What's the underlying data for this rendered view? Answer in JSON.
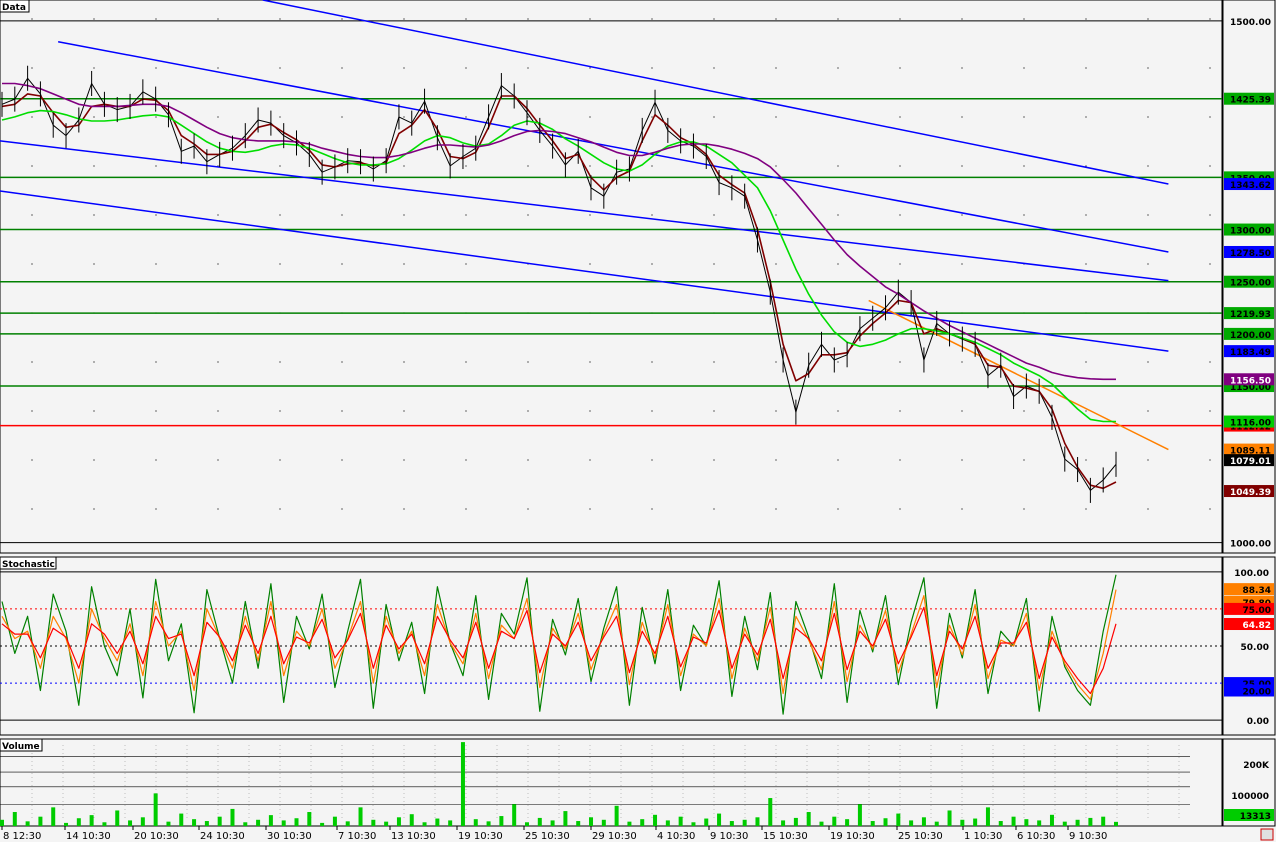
{
  "panels": {
    "price": {
      "title": "Data"
    },
    "stochastic": {
      "title": "Stochastic"
    },
    "volume": {
      "title": "Volume"
    }
  },
  "chart_data": [
    {
      "type": "line",
      "panel": "price",
      "title": "Data",
      "ylim": [
        990,
        1520
      ],
      "y_tick_labels": [
        1500.0,
        1000.0
      ],
      "horizontal_levels": [
        {
          "value": 1500.0,
          "color": "#000000",
          "label": "1500.00"
        },
        {
          "value": 1425.39,
          "color": "#008000",
          "label": "1425.39"
        },
        {
          "value": 1350.0,
          "color": "#008000",
          "label": "1350.00"
        },
        {
          "value": 1300.0,
          "color": "#008000",
          "label": "1300.00"
        },
        {
          "value": 1250.0,
          "color": "#008000",
          "label": "1250.00"
        },
        {
          "value": 1219.93,
          "color": "#008000",
          "label": "1219.93"
        },
        {
          "value": 1200.0,
          "color": "#008000",
          "label": "1200.00"
        },
        {
          "value": 1150.0,
          "color": "#008000",
          "label": "1150.00"
        },
        {
          "value": 1112.12,
          "color": "#ff0000",
          "label": "1112.12"
        },
        {
          "value": 1000.0,
          "color": "#000000",
          "label": "1000.00"
        }
      ],
      "axis_badges": [
        {
          "value": 1343.62,
          "label": "1343.62",
          "bg": "#0000ff",
          "fg": "#000000"
        },
        {
          "value": 1278.5,
          "label": "1278.50",
          "bg": "#0000ff",
          "fg": "#000000"
        },
        {
          "value": 1183.49,
          "label": "1183.49",
          "bg": "#0000ff",
          "fg": "#000000"
        },
        {
          "value": 1156.5,
          "label": "1156.50",
          "bg": "#800080",
          "fg": "#ffffff"
        },
        {
          "value": 1116.0,
          "label": "1116.00",
          "bg": "#00cc00",
          "fg": "#000000"
        },
        {
          "value": 1089.11,
          "label": "1089.11",
          "bg": "#ff8000",
          "fg": "#000000"
        },
        {
          "value": 1079.01,
          "label": "1079.01",
          "bg": "#000000",
          "fg": "#ffffff"
        },
        {
          "value": 1049.39,
          "label": "1049.39",
          "bg": "#800000",
          "fg": "#ffffff"
        }
      ],
      "trend_lines": [
        {
          "color": "#0000ff",
          "p1": [
            0.235,
            1520
          ],
          "p2": [
            0.978,
            1343.62
          ]
        },
        {
          "color": "#0000ff",
          "p1": [
            0.052,
            1480
          ],
          "p2": [
            0.978,
            1278.5
          ]
        },
        {
          "color": "#0000ff",
          "p1": [
            0.0,
            1385
          ],
          "p2": [
            0.978,
            1251
          ]
        },
        {
          "color": "#0000ff",
          "p1": [
            0.0,
            1337
          ],
          "p2": [
            0.978,
            1183.49
          ]
        },
        {
          "color": "#ff8000",
          "p1": [
            0.777,
            1232
          ],
          "p2": [
            0.978,
            1089.11
          ]
        }
      ],
      "series": [
        {
          "name": "",
          "role": "price",
          "color": "#000000",
          "values": [
            1420,
            1425,
            1445,
            1430,
            1400,
            1390,
            1405,
            1440,
            1420,
            1415,
            1418,
            1432,
            1425,
            1410,
            1375,
            1380,
            1365,
            1372,
            1378,
            1390,
            1405,
            1402,
            1390,
            1383,
            1372,
            1355,
            1360,
            1366,
            1365,
            1358,
            1366,
            1408,
            1402,
            1423,
            1388,
            1361,
            1370,
            1378,
            1408,
            1438,
            1428,
            1412,
            1395,
            1380,
            1362,
            1375,
            1340,
            1332,
            1355,
            1358,
            1395,
            1422,
            1395,
            1385,
            1380,
            1370,
            1345,
            1340,
            1332,
            1290,
            1240,
            1175,
            1125,
            1170,
            1190,
            1175,
            1180,
            1205,
            1215,
            1225,
            1240,
            1230,
            1175,
            1210,
            1200,
            1195,
            1190,
            1160,
            1170,
            1140,
            1150,
            1145,
            1120,
            1080,
            1070,
            1050,
            1060,
            1075
          ]
        },
        {
          "name": "",
          "role": "fast-ma",
          "color": "#800000",
          "values": [
            1418,
            1420,
            1430,
            1428,
            1412,
            1398,
            1400,
            1418,
            1420,
            1418,
            1418,
            1425,
            1424,
            1414,
            1390,
            1382,
            1372,
            1372,
            1375,
            1385,
            1398,
            1401,
            1393,
            1386,
            1376,
            1362,
            1360,
            1363,
            1364,
            1361,
            1364,
            1392,
            1400,
            1415,
            1396,
            1370,
            1368,
            1374,
            1398,
            1428,
            1428,
            1416,
            1400,
            1385,
            1368,
            1372,
            1350,
            1338,
            1350,
            1356,
            1385,
            1410,
            1400,
            1388,
            1382,
            1372,
            1352,
            1343,
            1335,
            1300,
            1250,
            1190,
            1155,
            1162,
            1180,
            1180,
            1182,
            1198,
            1210,
            1220,
            1232,
            1230,
            1200,
            1205,
            1200,
            1196,
            1190,
            1170,
            1168,
            1150,
            1148,
            1145,
            1128,
            1095,
            1072,
            1055,
            1052,
            1058
          ]
        },
        {
          "name": "",
          "role": "slow-ma",
          "color": "#00dd00",
          "values": [
            1405,
            1408,
            1412,
            1414,
            1413,
            1410,
            1406,
            1404,
            1404,
            1405,
            1407,
            1409,
            1410,
            1408,
            1400,
            1392,
            1384,
            1378,
            1375,
            1374,
            1376,
            1380,
            1382,
            1381,
            1378,
            1373,
            1368,
            1364,
            1362,
            1362,
            1363,
            1368,
            1376,
            1385,
            1390,
            1388,
            1383,
            1380,
            1382,
            1390,
            1400,
            1404,
            1402,
            1396,
            1387,
            1380,
            1372,
            1364,
            1358,
            1356,
            1362,
            1372,
            1380,
            1384,
            1384,
            1380,
            1372,
            1364,
            1352,
            1340,
            1318,
            1290,
            1262,
            1238,
            1218,
            1202,
            1192,
            1188,
            1190,
            1194,
            1200,
            1205,
            1205,
            1203,
            1200,
            1196,
            1192,
            1186,
            1180,
            1172,
            1166,
            1160,
            1152,
            1140,
            1128,
            1118,
            1116,
            1116
          ]
        },
        {
          "name": "",
          "role": "long-ma",
          "color": "#800080",
          "values": [
            1440,
            1440,
            1438,
            1435,
            1430,
            1425,
            1420,
            1418,
            1418,
            1418,
            1419,
            1420,
            1420,
            1418,
            1412,
            1405,
            1398,
            1392,
            1388,
            1386,
            1385,
            1385,
            1385,
            1384,
            1382,
            1378,
            1375,
            1372,
            1370,
            1369,
            1369,
            1371,
            1374,
            1378,
            1381,
            1381,
            1380,
            1379,
            1381,
            1385,
            1390,
            1394,
            1395,
            1394,
            1392,
            1388,
            1384,
            1379,
            1374,
            1371,
            1371,
            1374,
            1378,
            1381,
            1382,
            1382,
            1380,
            1377,
            1373,
            1368,
            1360,
            1348,
            1335,
            1320,
            1305,
            1290,
            1276,
            1265,
            1255,
            1245,
            1238,
            1230,
            1222,
            1215,
            1208,
            1202,
            1196,
            1190,
            1184,
            1178,
            1172,
            1168,
            1163,
            1160,
            1158,
            1157,
            1156.5,
            1156.5
          ]
        }
      ],
      "x_tick_labels": [
        "8 12:30",
        "14 10:30",
        "20 10:30",
        "24 10:30",
        "30 10:30",
        "7 10:30",
        "13 10:30",
        "19 10:30",
        "25 10:30",
        "29 10:30",
        "4 10:30",
        "9 10:30",
        "15 10:30",
        "19 10:30",
        "25 10:30",
        "1 10:30",
        "6 10:30",
        "9 10:30"
      ]
    },
    {
      "type": "line",
      "panel": "stochastic",
      "title": "Stochastic",
      "ylim": [
        0,
        100
      ],
      "y_tick_labels": [
        100.0,
        50.0,
        0.0
      ],
      "horizontal_levels": [
        {
          "value": 100,
          "color": "#000000",
          "style": "solid"
        },
        {
          "value": 75,
          "color": "#ff0000",
          "style": "dotted"
        },
        {
          "value": 50,
          "color": "#000000",
          "style": "dotted"
        },
        {
          "value": 25,
          "color": "#0000ff",
          "style": "dotted"
        },
        {
          "value": 0,
          "color": "#000000",
          "style": "solid"
        }
      ],
      "axis_badges": [
        {
          "value": 88.34,
          "label": "88.34",
          "bg": "#ff8000",
          "fg": "#000000"
        },
        {
          "value": 79.8,
          "label": "79.80",
          "bg": "#ff8000",
          "fg": "#000000"
        },
        {
          "value": 75.0,
          "label": "75.00",
          "bg": "#ff0000",
          "fg": "#000000"
        },
        {
          "value": 64.82,
          "label": "64.82",
          "bg": "#ff0000",
          "fg": "#ffffff"
        },
        {
          "value": 25.0,
          "label": "25.00",
          "bg": "#0000ff",
          "fg": "#000000"
        },
        {
          "value": 20.0,
          "label": "20.00",
          "bg": "#0000ff",
          "fg": "#000000"
        }
      ],
      "series": [
        {
          "name": "",
          "role": "%K",
          "color": "#008000",
          "values": [
            80,
            45,
            70,
            20,
            85,
            60,
            10,
            90,
            50,
            30,
            75,
            15,
            95,
            40,
            65,
            5,
            88,
            55,
            25,
            80,
            35,
            92,
            12,
            70,
            48,
            85,
            22,
            60,
            95,
            8,
            78,
            40,
            66,
            18,
            90,
            52,
            30,
            84,
            14,
            72,
            58,
            96,
            6,
            68,
            44,
            82,
            26,
            62,
            90,
            10,
            76,
            38,
            88,
            20,
            64,
            50,
            94,
            16,
            70,
            34,
            86,
            4,
            80,
            56,
            28,
            92,
            12,
            74,
            46,
            84,
            24,
            66,
            96,
            8,
            72,
            42,
            88,
            18,
            60,
            50,
            82,
            6,
            70,
            36,
            20,
            10,
            60,
            98
          ]
        },
        {
          "name": "",
          "role": "%D",
          "color": "#ff8000",
          "values": [
            70,
            55,
            60,
            35,
            70,
            55,
            25,
            75,
            55,
            40,
            65,
            30,
            80,
            50,
            60,
            20,
            75,
            55,
            35,
            70,
            40,
            80,
            30,
            60,
            50,
            75,
            35,
            55,
            80,
            25,
            70,
            45,
            60,
            30,
            78,
            52,
            38,
            72,
            28,
            64,
            55,
            82,
            22,
            62,
            48,
            72,
            34,
            58,
            78,
            24,
            66,
            42,
            78,
            30,
            58,
            50,
            82,
            28,
            62,
            40,
            76,
            18,
            70,
            54,
            34,
            80,
            26,
            64,
            48,
            74,
            32,
            58,
            84,
            22,
            64,
            44,
            78,
            28,
            54,
            50,
            72,
            20,
            60,
            38,
            24,
            14,
            45,
            88
          ]
        },
        {
          "name": "",
          "role": "%D-slow",
          "color": "#ff0000",
          "values": [
            65,
            58,
            58,
            42,
            62,
            56,
            35,
            65,
            58,
            45,
            60,
            38,
            70,
            55,
            58,
            30,
            66,
            56,
            40,
            64,
            45,
            70,
            38,
            56,
            52,
            68,
            42,
            54,
            72,
            35,
            64,
            48,
            58,
            38,
            70,
            54,
            42,
            66,
            35,
            60,
            55,
            74,
            32,
            58,
            50,
            66,
            40,
            56,
            70,
            32,
            60,
            45,
            70,
            36,
            56,
            52,
            74,
            35,
            58,
            44,
            68,
            28,
            62,
            55,
            40,
            72,
            34,
            60,
            50,
            68,
            38,
            56,
            76,
            30,
            60,
            48,
            70,
            35,
            52,
            52,
            66,
            28,
            56,
            40,
            28,
            18,
            35,
            65
          ]
        }
      ]
    },
    {
      "type": "bar",
      "panel": "volume",
      "title": "Volume",
      "y_tick_labels": [
        "200K",
        "100000"
      ],
      "ylim": [
        0,
        280000
      ],
      "axis_badges": [
        {
          "value": 13313,
          "label": "13313",
          "bg": "#00cc00",
          "fg": "#000000"
        }
      ],
      "series": [
        {
          "name": "",
          "color": "#00cc00",
          "values": [
            20000,
            45000,
            15000,
            30000,
            60000,
            10000,
            25000,
            35000,
            12000,
            50000,
            18000,
            28000,
            105000,
            14000,
            40000,
            22000,
            16000,
            30000,
            55000,
            12000,
            20000,
            35000,
            18000,
            25000,
            45000,
            10000,
            30000,
            15000,
            60000,
            20000,
            14000,
            28000,
            38000,
            12000,
            24000,
            18000,
            270000,
            22000,
            15000,
            32000,
            70000,
            12000,
            26000,
            18000,
            48000,
            16000,
            28000,
            20000,
            65000,
            14000,
            22000,
            36000,
            18000,
            30000,
            12000,
            24000,
            40000,
            16000,
            20000,
            28000,
            90000,
            18000,
            26000,
            45000,
            14000,
            30000,
            22000,
            70000,
            16000,
            25000,
            40000,
            18000,
            28000,
            14000,
            50000,
            20000,
            24000,
            60000,
            16000,
            30000,
            22000,
            18000,
            36000,
            14000,
            20000,
            26000,
            30000,
            13313
          ]
        }
      ]
    }
  ]
}
